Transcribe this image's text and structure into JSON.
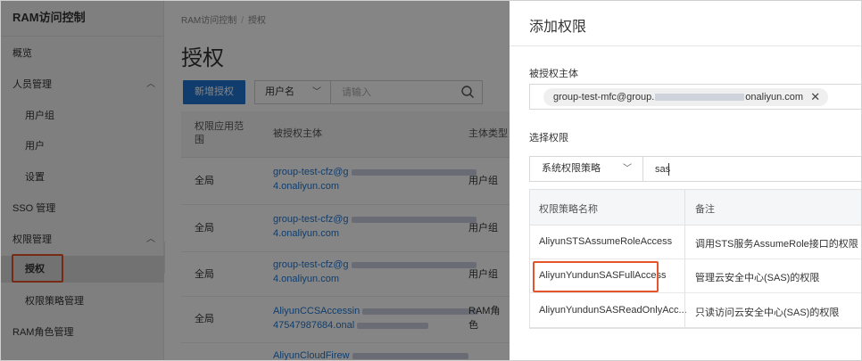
{
  "sidebar": {
    "title": "RAM访问控制",
    "items": [
      {
        "label": "概览"
      },
      {
        "label": "人员管理"
      },
      {
        "label": "用户组"
      },
      {
        "label": "用户"
      },
      {
        "label": "设置"
      },
      {
        "label": "SSO 管理"
      },
      {
        "label": "权限管理"
      },
      {
        "label": "授权"
      },
      {
        "label": "权限策略管理"
      },
      {
        "label": "RAM角色管理"
      }
    ]
  },
  "breadcrumb": {
    "root": "RAM访问控制",
    "sep": "/",
    "current": "授权"
  },
  "main": {
    "title": "授权",
    "new_button": "新增授权",
    "filter_select": "用户名",
    "search_placeholder": "请输入",
    "columns": [
      "权限应用范围",
      "被授权主体",
      "主体类型"
    ],
    "rows": [
      {
        "scope": "全局",
        "principal_a": "group-test-cfz@g",
        "principal_b": "4.onaliyun.com",
        "type": "用户组"
      },
      {
        "scope": "全局",
        "principal_a": "group-test-cfz@g",
        "principal_b": "4.onaliyun.com",
        "type": "用户组"
      },
      {
        "scope": "全局",
        "principal_a": "group-test-cfz@g",
        "principal_b": "4.onaliyun.com",
        "type": "用户组"
      },
      {
        "scope": "全局",
        "principal_a": "AliyunCCSAccessin",
        "principal_b": "47547987684.onal",
        "type_a": "RAM角",
        "type_b": "色"
      },
      {
        "principal_a": "AliyunCloudFirew"
      }
    ]
  },
  "drawer": {
    "title": "添加权限",
    "principal_label": "被授权主体",
    "principal_tag_prefix": "group-test-mfc@group.",
    "principal_tag_suffix": "onaliyun.com",
    "policy_label": "选择权限",
    "policy_type_select": "系统权限策略",
    "policy_search_value": "sas",
    "table_columns": [
      "权限策略名称",
      "备注"
    ],
    "policies": [
      {
        "name": "AliyunSTSAssumeRoleAccess",
        "note": "调用STS服务AssumeRole接口的权限"
      },
      {
        "name": "AliyunYundunSASFullAccess",
        "note": "管理云安全中心(SAS)的权限"
      },
      {
        "name": "AliyunYundunSASReadOnlyAcc...",
        "note": "只读访问云安全中心(SAS)的权限"
      }
    ]
  },
  "colors": {
    "primary": "#1f76d3",
    "highlight": "#e4542d",
    "link": "#1f76d3"
  }
}
